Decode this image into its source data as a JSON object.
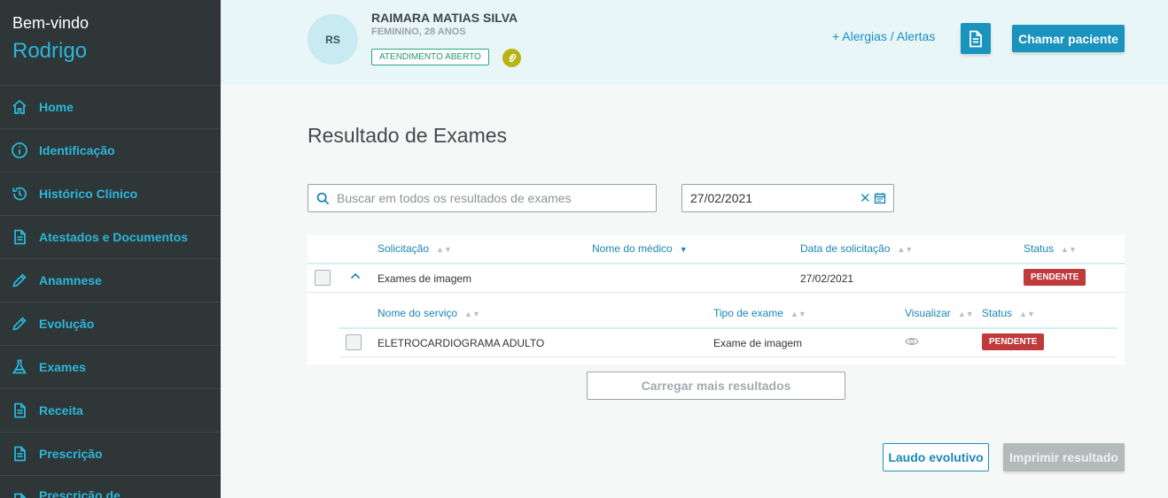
{
  "sidebar": {
    "welcome": "Bem-vindo",
    "user": "Rodrigo",
    "items": [
      {
        "label": "Home",
        "icon": "home-icon"
      },
      {
        "label": "Identificação",
        "icon": "info-icon"
      },
      {
        "label": "Histórico Clínico",
        "icon": "history-icon"
      },
      {
        "label": "Atestados e Documentos",
        "icon": "document-icon"
      },
      {
        "label": "Anamnese",
        "icon": "pencil-icon"
      },
      {
        "label": "Evolução",
        "icon": "pencil-icon"
      },
      {
        "label": "Exames",
        "icon": "flask-icon"
      },
      {
        "label": "Receita",
        "icon": "document-icon"
      },
      {
        "label": "Prescrição",
        "icon": "document-icon"
      },
      {
        "label": "Prescrição de",
        "icon": "document-icon"
      }
    ]
  },
  "header": {
    "avatar_initials": "RS",
    "patient_name": "RAIMARA MATIAS SILVA",
    "patient_info": "FEMININO, 28 ANOS",
    "status_badge": "ATENDIMENTO ABERTO",
    "allergy_link": "+ Alergias / Alertas",
    "call_button": "Chamar paciente"
  },
  "main": {
    "title": "Resultado de Exames",
    "search_placeholder": "Buscar em todos os resultados de exames",
    "date_value": "27/02/2021",
    "table": {
      "headers": [
        "Solicitação",
        "Nome do médico",
        "Data de solicitação",
        "Status"
      ],
      "row": {
        "solicitacao": "Exames de imagem",
        "medico": "",
        "data": "27/02/2021",
        "status": "PENDENTE"
      },
      "sub_headers": [
        "Nome do serviço",
        "Tipo de exame",
        "Visualizar",
        "Status"
      ],
      "sub_row": {
        "servico": "ELETROCARDIOGRAMA ADULTO",
        "tipo": "Exame de imagem",
        "status": "PENDENTE"
      }
    },
    "load_more": "Carregar mais resultados",
    "laudo_button": "Laudo evolutivo",
    "print_button": "Imprimir resultado"
  },
  "colors": {
    "sidebar_bg": "#2f3638",
    "accent": "#1a93bf",
    "header_bg": "#e8f6f8",
    "pending": "#c0393b",
    "open_badge": "#2aa77c"
  }
}
